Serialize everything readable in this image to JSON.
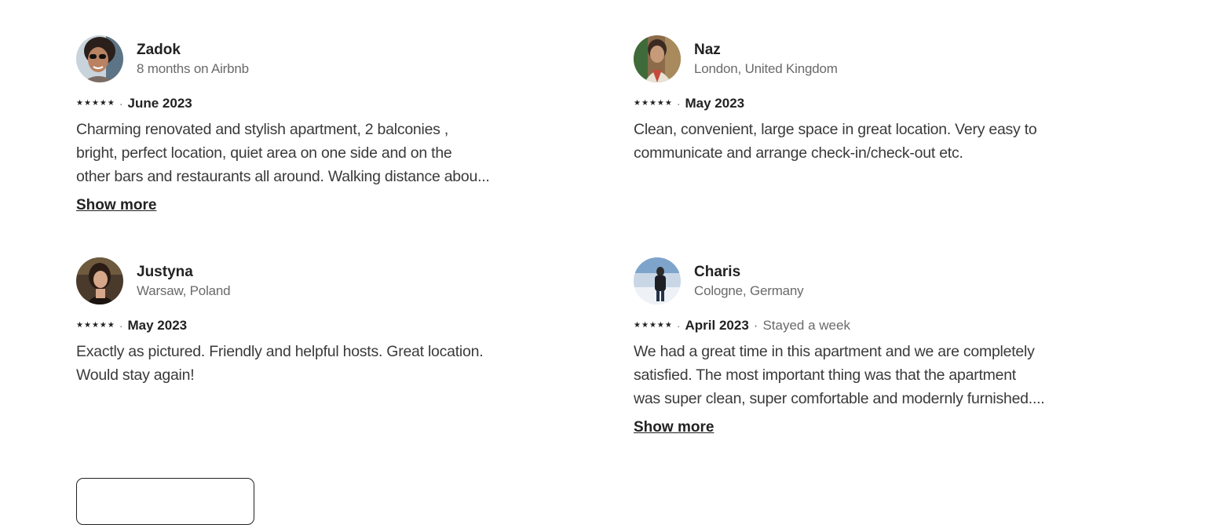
{
  "reviews": [
    {
      "name": "Zadok",
      "subtitle": "8 months on Airbnb",
      "rating": 5,
      "date": "June 2023",
      "stay": "",
      "lines": [
        "Charming renovated and stylish apartment, 2 balconies ,",
        "bright, perfect location, quiet area on one side and on the",
        "other bars and restaurants all around. Walking distance abou..."
      ],
      "show_more": "Show more"
    },
    {
      "name": "Naz",
      "subtitle": "London, United Kingdom",
      "rating": 5,
      "date": "May 2023",
      "stay": "",
      "lines": [
        "Clean, convenient, large space in great location. Very easy to",
        "communicate and arrange check-in/check-out etc."
      ],
      "show_more": ""
    },
    {
      "name": "Justyna",
      "subtitle": "Warsaw, Poland",
      "rating": 5,
      "date": "May 2023",
      "stay": "",
      "lines": [
        "Exactly as pictured. Friendly and helpful hosts. Great location.",
        "Would stay again!"
      ],
      "show_more": ""
    },
    {
      "name": "Charis",
      "subtitle": "Cologne, Germany",
      "rating": 5,
      "date": "April 2023",
      "stay": "Stayed a week",
      "lines": [
        "We had a great time in this apartment and we are completely",
        "satisfied. The most important thing was that the apartment",
        "was super clean, super comfortable and modernly furnished...."
      ],
      "show_more": "Show more"
    }
  ],
  "separator": "·",
  "star_glyph": "★",
  "colors": {
    "text_primary": "#222222",
    "text_secondary": "#6a6a6a",
    "body_text": "#3a3a3a"
  }
}
